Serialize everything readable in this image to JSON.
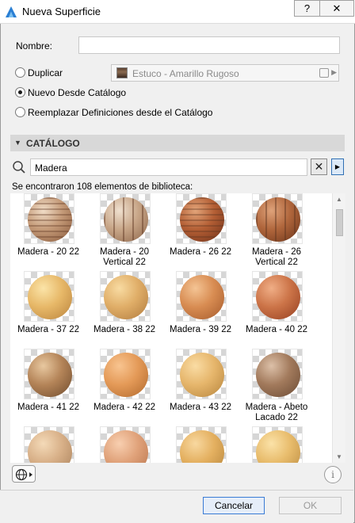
{
  "window": {
    "title": "Nueva Superficie",
    "help_label": "?",
    "close_label": "✕"
  },
  "form": {
    "name_label": "Nombre:",
    "name_value": "",
    "duplicate_label": "Duplicar",
    "duplicate_value": "Estuco - Amarillo Rugoso",
    "new_from_catalog_label": "Nuevo Desde Catálogo",
    "replace_label": "Reemplazar Definiciones desde el Catálogo",
    "selected_option": "new_from_catalog"
  },
  "catalog": {
    "section_title": "CATÁLOGO",
    "search_value": "Madera",
    "results_text": "Se encontraron 108 elementos de biblioteca:",
    "items": [
      {
        "label": "Madera - 20 22",
        "colors": [
          "#f0dcc6",
          "#c49a78",
          "#8a5a3c"
        ],
        "stripes": "h"
      },
      {
        "label": "Madera - 20 Vertical 22",
        "colors": [
          "#efe0cf",
          "#c8a688",
          "#8c6448"
        ],
        "stripes": "v"
      },
      {
        "label": "Madera - 26 22",
        "colors": [
          "#e2a479",
          "#b45f35",
          "#6e3018"
        ],
        "stripes": "h"
      },
      {
        "label": "Madera - 26 Vertical 22",
        "colors": [
          "#dea27a",
          "#b0663c",
          "#6a3218"
        ],
        "stripes": "v"
      },
      {
        "label": "Madera - 37 22",
        "colors": [
          "#fbe4a8",
          "#e7b868",
          "#b9823c"
        ],
        "stripes": "none"
      },
      {
        "label": "Madera - 38 22",
        "colors": [
          "#f8dba2",
          "#e0ae68",
          "#b07a3e"
        ],
        "stripes": "none"
      },
      {
        "label": "Madera - 39 22",
        "colors": [
          "#f4c494",
          "#d88c52",
          "#a45a2c"
        ],
        "stripes": "none"
      },
      {
        "label": "Madera - 40 22",
        "colors": [
          "#f0ae86",
          "#cc7448",
          "#943e20"
        ],
        "stripes": "none"
      },
      {
        "label": "Madera - 41 22",
        "colors": [
          "#e8c8a0",
          "#b48458",
          "#6e4a2c"
        ],
        "stripes": "none"
      },
      {
        "label": "Madera - 42 22",
        "colors": [
          "#f8c490",
          "#e49a58",
          "#b0682c"
        ],
        "stripes": "none"
      },
      {
        "label": "Madera - 43 22",
        "colors": [
          "#fadca4",
          "#e6b66c",
          "#b6843c"
        ],
        "stripes": "none"
      },
      {
        "label": "Madera - Abeto Lacado 22",
        "colors": [
          "#dcc0a8",
          "#a27a5c",
          "#6a4a34"
        ],
        "stripes": "none"
      },
      {
        "label": "",
        "colors": [
          "#f4dab8",
          "#d8b088",
          "#a8805a"
        ],
        "stripes": "none"
      },
      {
        "label": "",
        "colors": [
          "#f8cfb0",
          "#e0a27a",
          "#b8744c"
        ],
        "stripes": "none"
      },
      {
        "label": "",
        "colors": [
          "#f8d8a0",
          "#e4b060",
          "#b4843c"
        ],
        "stripes": "none"
      },
      {
        "label": "",
        "colors": [
          "#fbe2a8",
          "#e8bc6c",
          "#ba8a40"
        ],
        "stripes": "none"
      }
    ]
  },
  "footer": {
    "cancel_label": "Cancelar",
    "ok_label": "OK"
  },
  "icons": {
    "app": "archicad-icon",
    "search": "search-icon",
    "globe": "globe-icon",
    "info": "info-icon"
  },
  "colors": {
    "section_header": "#d8d8d8",
    "accent": "#3a7bd5"
  }
}
